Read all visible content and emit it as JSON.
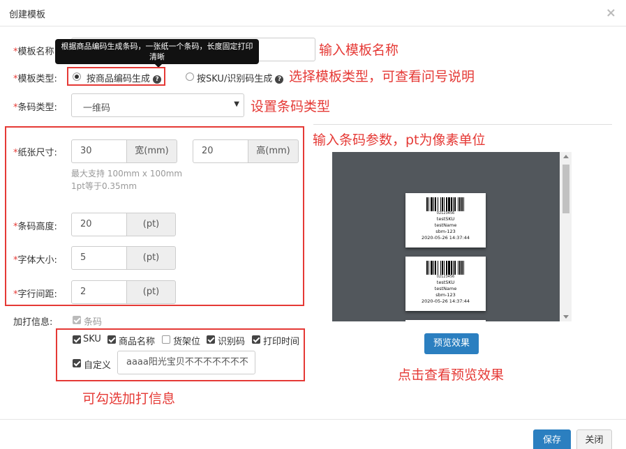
{
  "modal": {
    "title": "创建模板",
    "close_icon": "×"
  },
  "form": {
    "required_mark": "*",
    "template_name_label": "模板名称:",
    "template_type_label": "模板类型:",
    "type_option_product": "按商品编码生成",
    "type_option_sku": "按SKU/识别码生成",
    "help_icon": "?",
    "tooltip_text": "根据商品编码生成条码，一张纸一个条码，长度固定打印清晰",
    "barcode_type_label": "条码类型:",
    "barcode_type_value": "一维码",
    "paper_size_label": "纸张尺寸:",
    "width_value": "30",
    "width_unit": "宽(mm)",
    "height_value": "20",
    "height_unit": "高(mm)",
    "hint_max": "最大支持 100mm x 100mm",
    "hint_pt": "1pt等于0.35mm",
    "barcode_height_label": "条码高度:",
    "barcode_height_value": "20",
    "font_size_label": "字体大小:",
    "font_size_value": "5",
    "line_spacing_label": "字行间距:",
    "line_spacing_value": "2",
    "pt_unit": "(pt)",
    "extra_info_label": "加打信息:",
    "cb_barcode": "条码",
    "cb_sku": "SKU",
    "cb_product_name": "商品名称",
    "cb_shelf": "货架位",
    "cb_id_code": "识别码",
    "cb_print_time": "打印时间",
    "cb_custom": "自定义",
    "custom_value": "aaaa阳光宝贝不不不不不不不"
  },
  "annotations": {
    "name": "输入模板名称",
    "type": "选择模板类型，可查看问号说明",
    "barcode_type": "设置条码类型",
    "params": "输入条码参数，pt为像素单位",
    "preview": "点击查看预览效果",
    "extra": "可勾选加打信息"
  },
  "preview_labels": [
    {
      "code": "02123456",
      "sku": "testSKU",
      "name": "testName",
      "id": "sbm-123",
      "time": "2020-05-26 14:37:44"
    },
    {
      "code": "02123456",
      "sku": "testSKU",
      "name": "testName",
      "id": "sbm-123",
      "time": "2020-05-26 14:37:44"
    }
  ],
  "buttons": {
    "preview": "预览效果",
    "save": "保存",
    "close": "关闭"
  },
  "colors": {
    "primary": "#2b7fc0",
    "annotation": "#e53935"
  }
}
